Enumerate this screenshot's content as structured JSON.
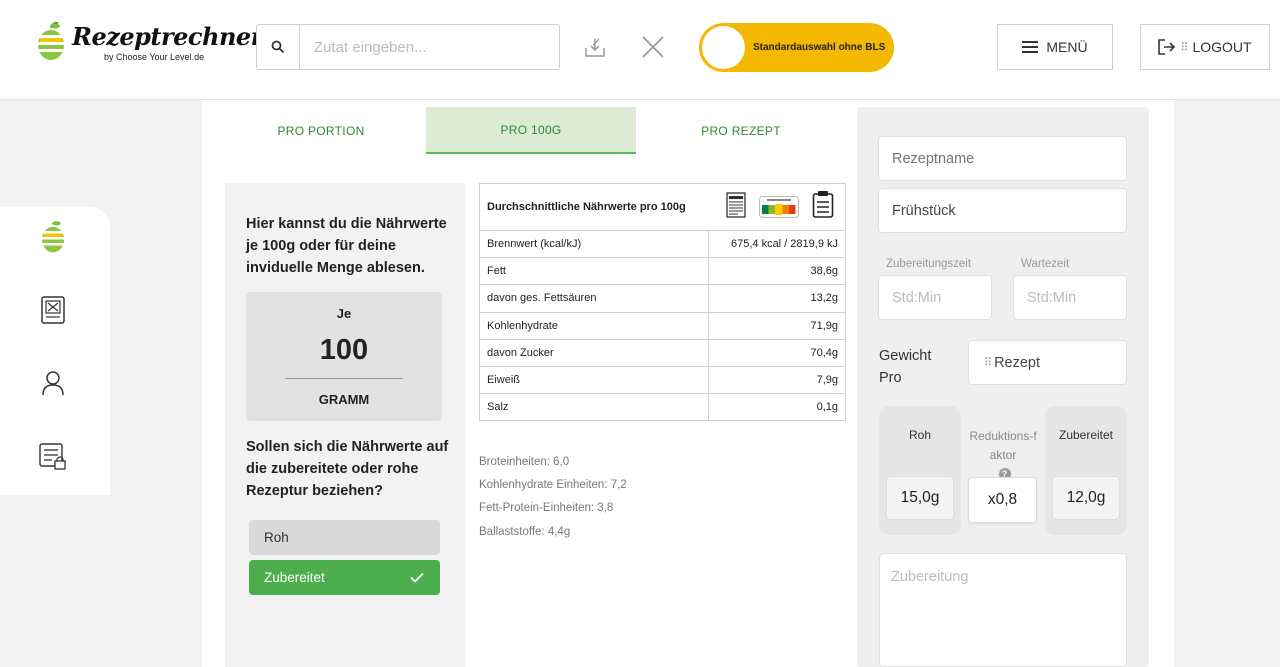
{
  "header": {
    "logo_text": "Rezeptrechner",
    "logo_sub": "by Choose Your Level.de",
    "search_placeholder": "Zutat eingeben...",
    "toggle_label": "Standardauswahl ohne BLS",
    "menu_label": "MENÜ",
    "logout_label": "LOGOUT"
  },
  "tabs": [
    {
      "label": "PRO PORTION",
      "active": false
    },
    {
      "label": "PRO 100G",
      "active": true
    },
    {
      "label": "PRO REZEPT",
      "active": false
    }
  ],
  "info": {
    "text": "Hier kannst du die Nährwerte je 100g oder für deine inviduelle Menge ablesen.",
    "je_label": "Je",
    "amount": "100",
    "unit": "GRAMM",
    "question": "Sollen sich die Nährwerte auf die zubereitete oder rohe Rezeptur beziehen?",
    "option_raw": "Roh",
    "option_cooked": "Zubereitet"
  },
  "nutrition": {
    "title": "Durchschnittliche Nährwerte pro 100g",
    "rows": [
      {
        "label": "Brennwert (kcal/kJ)",
        "value": "675,4 kcal / 2819,9 kJ"
      },
      {
        "label": "Fett",
        "value": "38,6g"
      },
      {
        "label": "davon ges. Fettsäuren",
        "value": "13,2g"
      },
      {
        "label": "Kohlenhydrate",
        "value": "71,9g"
      },
      {
        "label": "davon Zucker",
        "value": "70,4g"
      },
      {
        "label": "Eiweiß",
        "value": "7,9g"
      },
      {
        "label": "Salz",
        "value": "0,1g"
      }
    ],
    "extra": [
      "Broteinheiten: 6,0",
      "Kohlenhydrate Einheiten: 7,2",
      "Fett-Protein-Einheiten: 3,8",
      "Ballaststoffe: 4,4g"
    ]
  },
  "recipe": {
    "name_placeholder": "Rezeptname",
    "meal_value": "Frühstück",
    "prep_label": "Zubereitungszeit",
    "wait_label": "Wartezeit",
    "time_placeholder": "Std:Min",
    "weight_label": "Gewicht Pro",
    "weight_select": "Rezept",
    "raw_label": "Roh",
    "raw_value": "15,0g",
    "reduction_label": "Reduktions-faktor",
    "reduction_value": "x0,8",
    "cooked_label": "Zubereitet",
    "cooked_value": "12,0g",
    "preparation_placeholder": "Zubereitung"
  },
  "colors": {
    "accent_green": "#4cae4c",
    "tab_green": "#2e8a2e",
    "toggle_yellow": "#f5b800"
  }
}
